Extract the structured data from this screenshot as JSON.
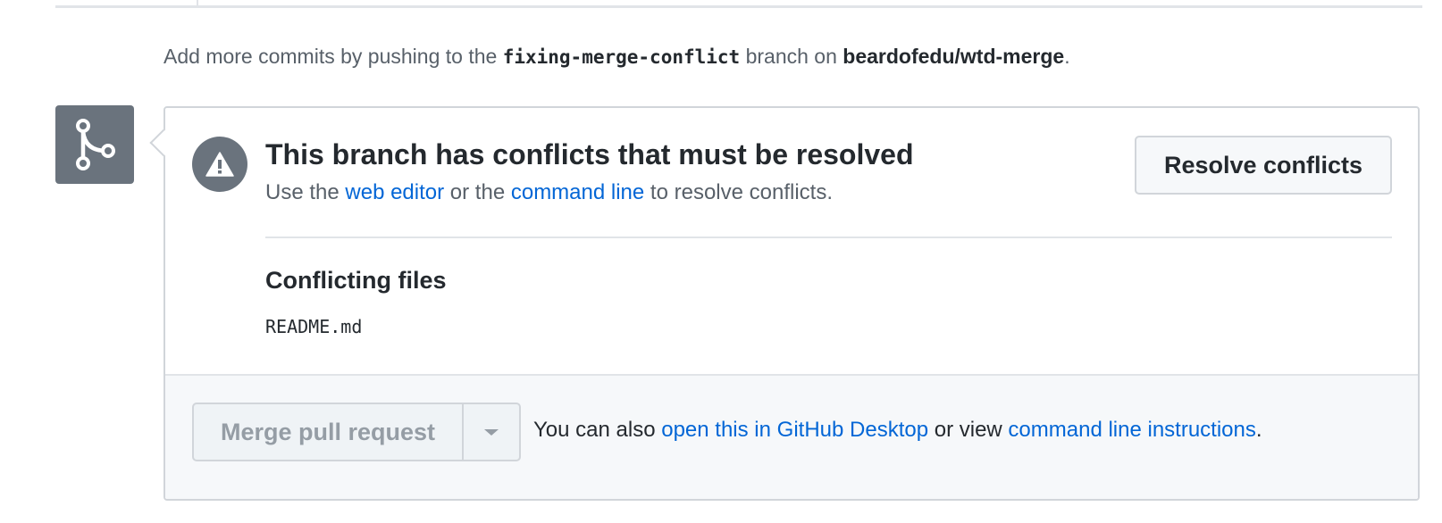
{
  "push_note": {
    "prefix": "Add more commits by pushing to the ",
    "branch": "fixing-merge-conflict",
    "middle": " branch on ",
    "repo": "beardofedu/wtd-merge",
    "suffix": "."
  },
  "icons": {
    "timeline": "git-merge-icon",
    "alert": "alert-triangle-icon",
    "dropdown": "triangle-down-icon"
  },
  "conflict": {
    "title": "This branch has conflicts that must be resolved",
    "sub_prefix": "Use the ",
    "web_editor_link": "web editor",
    "sub_middle": " or the ",
    "command_line_link": "command line",
    "sub_suffix": " to resolve conflicts.",
    "resolve_button": "Resolve conflicts"
  },
  "files": {
    "heading": "Conflicting files",
    "items": [
      "README.md"
    ]
  },
  "footer": {
    "merge_button": "Merge pull request",
    "text_prefix": "You can also ",
    "desktop_link": "open this in GitHub Desktop",
    "text_middle": " or view ",
    "instructions_link": "command line instructions",
    "text_suffix": "."
  },
  "colors": {
    "link": "#0366d6",
    "icon_bg": "#6a737d",
    "border": "#d1d5da",
    "disabled_text": "#959da5"
  }
}
